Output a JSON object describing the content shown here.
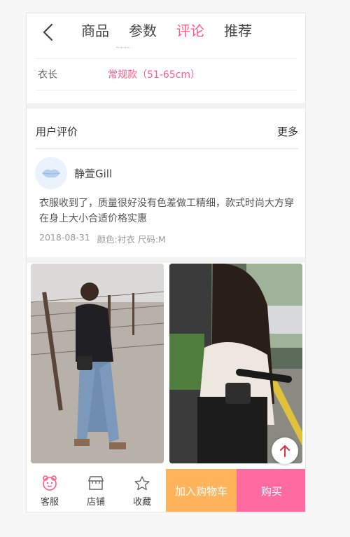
{
  "header": {
    "tabs": [
      {
        "label": "商品"
      },
      {
        "label": "参数"
      },
      {
        "label": "评论"
      },
      {
        "label": "推荐"
      }
    ],
    "active_tab": "评论"
  },
  "specs": {
    "rows": [
      {
        "label": "衣长",
        "value": "常规款（51-65cm）"
      }
    ]
  },
  "reviews": {
    "title": "用户评价",
    "more_label": "更多",
    "items": [
      {
        "username": "静萱Gill",
        "text": "衣服收到了，质量很好没有色差做工精细，款式时尚大方穿在身上大小合适价格实惠",
        "date": "2018-08-31",
        "attrs": "颜色:衬衣 尺码:M"
      }
    ]
  },
  "bottom_bar": {
    "items": [
      {
        "label": "客服",
        "icon": "customer-service-icon"
      },
      {
        "label": "店铺",
        "icon": "store-icon"
      },
      {
        "label": "收藏",
        "icon": "star-icon"
      }
    ],
    "cart_label": "加入购物车",
    "buy_label": "购买"
  },
  "colors": {
    "accent": "#ff5a8a",
    "cart": "#ffb35a",
    "buy": "#ff6ba0"
  }
}
